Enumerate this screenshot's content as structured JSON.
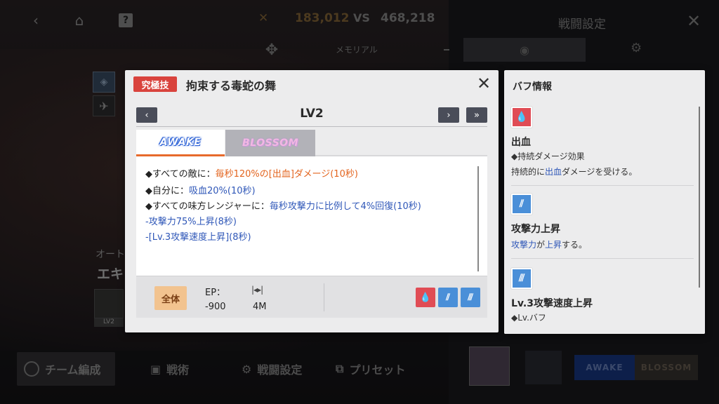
{
  "topbar": {
    "back_icon": "chevron-left-icon",
    "home_icon": "home-icon",
    "help_label": "?",
    "cross_symbol": "✕",
    "score_left": "183,012",
    "vs_label": "VS",
    "score_right": "468,218",
    "memorial_label": "メモリアル"
  },
  "battle_settings": {
    "title": "戦闘設定",
    "close_icon": "close-icon"
  },
  "background": {
    "auto_label": "オート",
    "character_label": "エキ",
    "skill_level_tag": "LV2"
  },
  "bottombar": {
    "team_label": "チーム編成",
    "tactics_label": "戦術",
    "battle_setting_label": "戦闘設定",
    "preset_label": "プリセット"
  },
  "right_bottom": {
    "awake_label": "AWAKE",
    "blossom_label": "BLOSSOM"
  },
  "skill_popup": {
    "badge": "究極技",
    "name": "拘束する毒蛇の舞",
    "level": "LV2",
    "tabs": {
      "awake": "AWAKE",
      "blossom": "BLOSSOM"
    },
    "desc": {
      "line1_prefix": "◆すべての敵に：",
      "line1_highlight": "毎秒120%の[出血]ダメージ(10秒)",
      "line2_prefix": "◆自分に：",
      "line2_highlight": "吸血20%(10秒)",
      "line3_prefix": "◆すべての味方レンジャーに：",
      "line3_highlight": "毎秒攻撃力に比例して4%回復(10秒)",
      "line4": "-攻撃力75%上昇(8秒)",
      "line5": "-[Lv.3攻撃速度上昇](8秒)"
    },
    "target_label": "全体",
    "ep_label": "EP：",
    "ep_value": "-900",
    "range_value": "4M",
    "icons": [
      "bleed-icon",
      "attack-up-icon",
      "attack-speed-up-icon"
    ]
  },
  "buff_panel": {
    "title": "バフ情報",
    "items": [
      {
        "name": "出血",
        "sub": "◆持続ダメージ効果",
        "desc_prefix": "持続的に",
        "desc_highlight": "出血",
        "desc_suffix": "ダメージを受ける。"
      },
      {
        "name": "攻撃力上昇",
        "desc_highlight1": "攻撃力",
        "desc_mid": "が",
        "desc_highlight2": "上昇",
        "desc_suffix": "する。"
      },
      {
        "name": "Lv.3攻撃速度上昇",
        "sub": "◆Lv.バフ"
      }
    ]
  },
  "colors": {
    "ultimate_badge": "#d9433d",
    "orange_highlight": "#e3641e",
    "blue_highlight": "#2f57b8",
    "bleed_icon_bg": "#e04c55",
    "buff_icon_bg": "#4a8fd8",
    "tab_active_underline": "#e76a2c",
    "target_button": "#f2c38f"
  }
}
